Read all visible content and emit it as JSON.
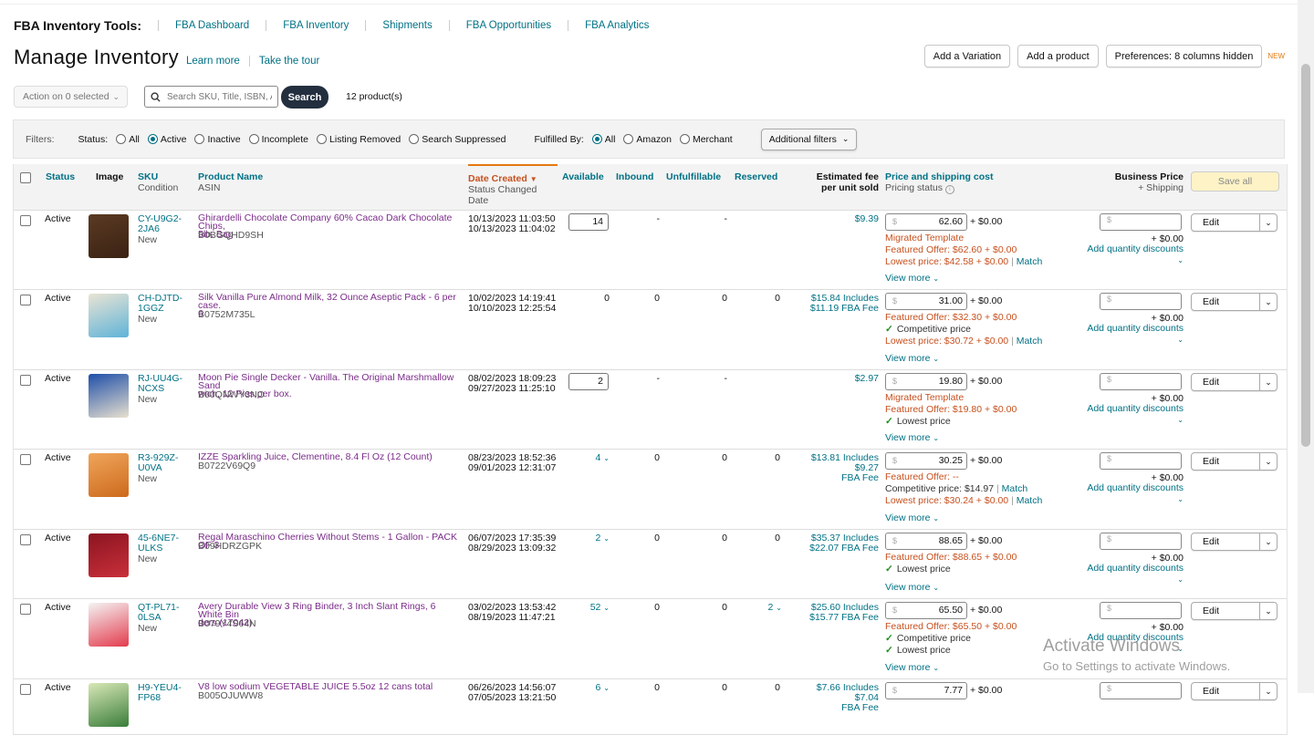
{
  "toolbar": {
    "title": "FBA Inventory Tools:",
    "links": [
      "FBA Dashboard",
      "FBA Inventory",
      "Shipments",
      "FBA Opportunities",
      "FBA Analytics"
    ]
  },
  "page": {
    "title": "Manage Inventory",
    "learn_more": "Learn more",
    "take_tour": "Take the tour",
    "add_variation": "Add a Variation",
    "add_product": "Add a product",
    "preferences": "Preferences: 8 columns hidden",
    "new_tag": "NEW"
  },
  "controls": {
    "action_dropdown": "Action on 0 selected",
    "search_placeholder": "Search SKU, Title, ISBN, ASIN",
    "search_button": "Search",
    "product_count": "12 product(s)"
  },
  "filters": {
    "label": "Filters:",
    "status_label": "Status:",
    "status_options": [
      "All",
      "Active",
      "Inactive",
      "Incomplete",
      "Listing Removed",
      "Search Suppressed"
    ],
    "status_selected": "Active",
    "fulfilled_label": "Fulfilled By:",
    "fulfilled_options": [
      "All",
      "Amazon",
      "Merchant"
    ],
    "fulfilled_selected": "All",
    "additional": "Additional filters"
  },
  "columns": {
    "status": "Status",
    "image": "Image",
    "sku": "SKU",
    "sku_sub": "Condition",
    "product": "Product Name",
    "product_sub": "ASIN",
    "date": "Date Created",
    "date_sub": "Status Changed Date",
    "available": "Available",
    "inbound": "Inbound",
    "unfulfillable": "Unfulfillable",
    "reserved": "Reserved",
    "fee": "Estimated fee per unit sold",
    "price": "Price and shipping cost",
    "price_sub": "Pricing status",
    "business": "Business Price",
    "business_sub": "+ Shipping",
    "save_all": "Save all"
  },
  "rows": [
    {
      "status": "Active",
      "sku1": "CY-U9G2-",
      "sku2": "2JA6",
      "cond": "New",
      "name1": "Ghirardelli Chocolate Company 60% Cacao Dark Chocolate Chips,",
      "name2": "5lb. Bag",
      "asin": "B0BGQHD9SH",
      "created": "10/13/2023 11:03:50",
      "changed": "10/13/2023 11:04:02",
      "available": "14",
      "inbound": "-",
      "unfulfillable": "-",
      "reserved": "",
      "fee1": "$9.39",
      "fee2": "",
      "price": "62.60",
      "ship": "+ $0.00",
      "l1": "Migrated Template",
      "l2": "Featured Offer: $62.60 + $0.00",
      "l3": "Lowest price: $42.58 + $0.00",
      "l3b": "Match",
      "view": "View more"
    },
    {
      "status": "Active",
      "sku1": "CH-DJTD-",
      "sku2": "1GGZ",
      "cond": "New",
      "name1": "Silk Vanilla Pure Almond Milk, 32 Ounce Aseptic Pack - 6 per case.",
      "name2": "6",
      "asin": "B0752M735L",
      "created": "10/02/2023 14:19:41",
      "changed": "10/10/2023 12:25:54",
      "available": "0",
      "inbound": "0",
      "unfulfillable": "0",
      "reserved": "0",
      "fee1": "$15.84 Includes",
      "fee2": "$11.19 FBA Fee",
      "price": "31.00",
      "ship": "+ $0.00",
      "l1": "Featured Offer: $32.30 + $0.00",
      "l2": "Competitive price",
      "l3": "Lowest price: $30.72 + $0.00",
      "l3b": "Match",
      "view": "View more"
    },
    {
      "status": "Active",
      "sku1": "RJ-UU4G-",
      "sku2": "NCXS",
      "cond": "New",
      "name1": "Moon Pie Single Decker - Vanilla. The Original Marshmallow Sand",
      "name2": "wich, 12 Pies per box.",
      "asin": "B00QNWY3NO",
      "created": "08/02/2023 18:09:23",
      "changed": "09/27/2023 11:25:10",
      "available": "2",
      "inbound": "-",
      "unfulfillable": "-",
      "reserved": "",
      "fee1": "$2.97",
      "fee2": "",
      "price": "19.80",
      "ship": "+ $0.00",
      "l1": "Migrated Template",
      "l2": "Featured Offer: $19.80 + $0.00",
      "l3": "Lowest price",
      "l3b": "",
      "view": "View more"
    },
    {
      "status": "Active",
      "sku1": "R3-929Z-",
      "sku2": "U0VA",
      "cond": "New",
      "name1": "IZZE Sparkling Juice, Clementine, 8.4 Fl Oz (12 Count)",
      "name2": "",
      "asin": "B0722V69Q9",
      "created": "08/23/2023 18:52:36",
      "changed": "09/01/2023 12:31:07",
      "available": "4",
      "inbound": "0",
      "unfulfillable": "0",
      "reserved": "0",
      "fee1": "$13.81 Includes $9.27",
      "fee2": "FBA Fee",
      "price": "30.25",
      "ship": "+ $0.00",
      "l1": "Featured Offer: --",
      "l2": "Competitive price: $14.97",
      "l2b": "Match",
      "l3": "Lowest price: $30.24 + $0.00",
      "l3b": "Match",
      "view": "View more"
    },
    {
      "status": "Active",
      "sku1": "45-6NE7-",
      "sku2": "ULKS",
      "cond": "New",
      "name1": "Regal Maraschino Cherries Without Stems - 1 Gallon - PACK OF 3",
      "name2": "",
      "asin": "B09HDRZGPK",
      "created": "06/07/2023 17:35:39",
      "changed": "08/29/2023 13:09:32",
      "available": "2",
      "inbound": "0",
      "unfulfillable": "0",
      "reserved": "0",
      "fee1": "$35.37 Includes",
      "fee2": "$22.07 FBA Fee",
      "price": "88.65",
      "ship": "+ $0.00",
      "l1": "Featured Offer: $88.65 + $0.00",
      "l2": "Lowest price",
      "l3": "",
      "l3b": "",
      "view": "View more"
    },
    {
      "status": "Active",
      "sku1": "QT-PL71-",
      "sku2": "0LSA",
      "cond": "New",
      "name1": "Avery Durable View 3 Ring Binder, 3 Inch Slant Rings, 6 White Bin",
      "name2": "ders (17042)",
      "asin": "B079Y4S64N",
      "created": "03/02/2023 13:53:42",
      "changed": "08/19/2023 11:47:21",
      "available": "52",
      "inbound": "0",
      "unfulfillable": "0",
      "reserved": "2",
      "fee1": "$25.60 Includes",
      "fee2": "$15.77 FBA Fee",
      "price": "65.50",
      "ship": "+ $0.00",
      "l1": "Featured Offer: $65.50 + $0.00",
      "l2": "Competitive price",
      "l3": "Lowest price",
      "l3b": "",
      "view": "View more"
    },
    {
      "status": "Active",
      "sku1": "H9-YEU4-",
      "sku2": "FP68",
      "cond": "",
      "name1": "V8 low sodium VEGETABLE JUICE 5.5oz 12 cans total",
      "name2": "",
      "asin": "B005OJUWW8",
      "created": "06/26/2023 14:56:07",
      "changed": "07/05/2023 13:21:50",
      "available": "6",
      "inbound": "0",
      "unfulfillable": "0",
      "reserved": "0",
      "fee1": "$7.66 Includes $7.04",
      "fee2": "FBA Fee",
      "price": "7.77",
      "ship": "+ $0.00",
      "l1": "",
      "l2": "",
      "l3": "",
      "l3b": "",
      "view": ""
    }
  ],
  "shared": {
    "edit": "Edit",
    "biz_ship": "+ $0.00",
    "qty_discounts": "Add quantity discounts",
    "dollar": "$"
  },
  "watermark": {
    "line1": "Activate Windows",
    "line2": "Go to Settings to activate Windows."
  }
}
